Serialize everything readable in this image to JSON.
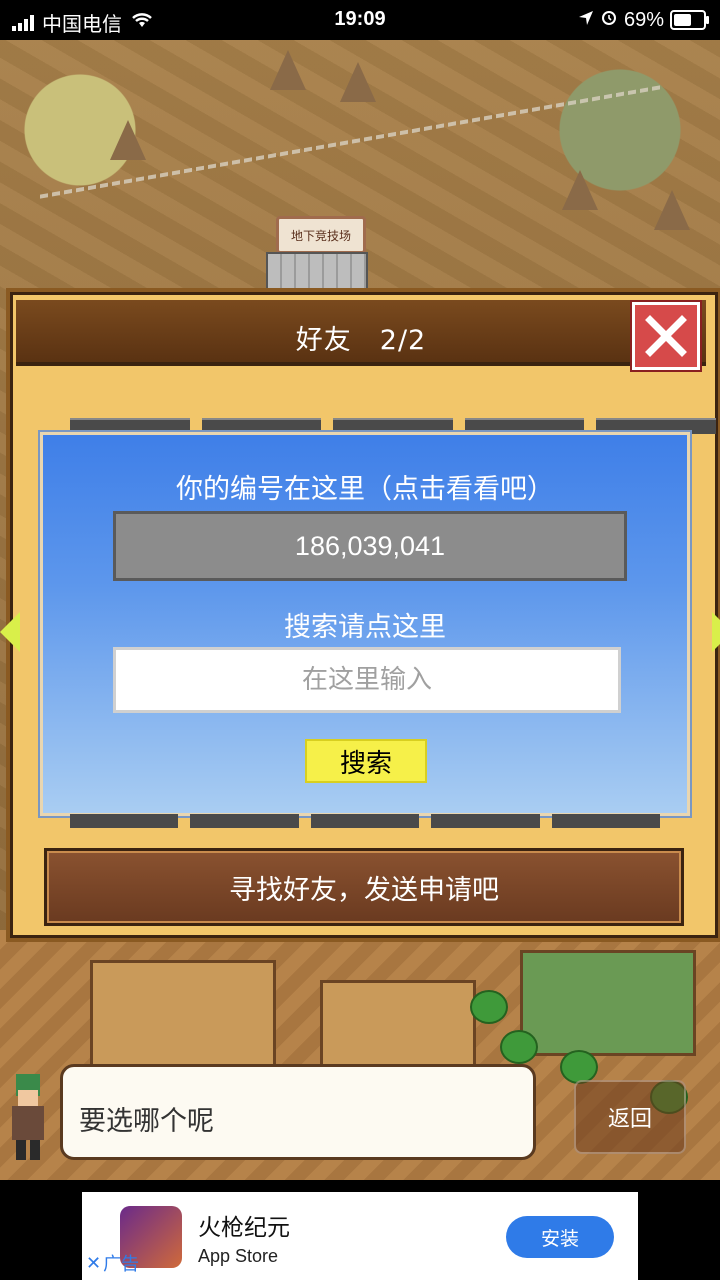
{
  "status_bar": {
    "carrier": "中国电信",
    "time": "19:09",
    "battery": "69%",
    "battery_level": 0.69
  },
  "scene": {
    "arena_sign": "地下竞技场"
  },
  "friend_dialog": {
    "title": "好友　2/2",
    "close_icon": "close-icon",
    "id_label": "你的编号在这里（点击看看吧）",
    "player_id": "186,039,041",
    "search_label": "搜索请点这里",
    "search_placeholder": "在这里输入",
    "search_value": "",
    "search_button": "搜索",
    "find_friends_button": "寻找好友，发送申请吧"
  },
  "message": {
    "text": "要选哪个呢",
    "back_button": "返回"
  },
  "ad": {
    "app_name": "火枪纪元",
    "source": "App Store",
    "install_button": "安装",
    "ad_label": "广告"
  },
  "colors": {
    "dialog_bg": "#f2c66a",
    "panel_blue": "#3f7fe8",
    "search_button": "#f6f049",
    "install_button": "#2f7be8",
    "close_button": "#d64a4a"
  }
}
